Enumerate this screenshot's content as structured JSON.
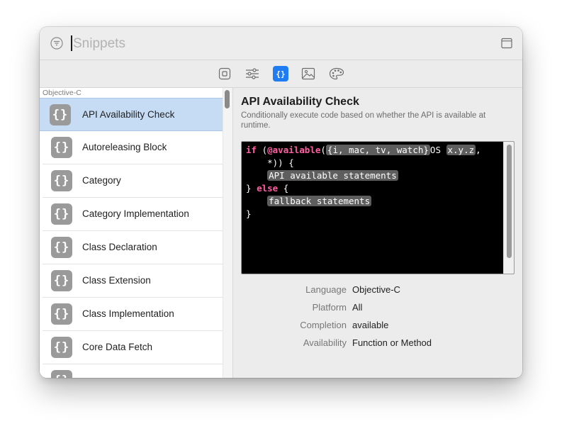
{
  "search": {
    "placeholder": "Snippets",
    "value": ""
  },
  "toolbar": {
    "tabs": [
      {
        "icon": "square-icon"
      },
      {
        "icon": "sliders-icon"
      },
      {
        "icon": "braces-icon",
        "active": true
      },
      {
        "icon": "image-icon"
      },
      {
        "icon": "palette-icon"
      }
    ],
    "accent": "#1f7cf2"
  },
  "sidebar": {
    "group_label": "Objective-C",
    "icon_glyph": "{}",
    "items": [
      {
        "label": "API Availability Check",
        "selected": true
      },
      {
        "label": "Autoreleasing Block"
      },
      {
        "label": "Category"
      },
      {
        "label": "Category Implementation"
      },
      {
        "label": "Class Declaration"
      },
      {
        "label": "Class Extension"
      },
      {
        "label": "Class Implementation"
      },
      {
        "label": "Core Data Fetch"
      },
      {
        "label": ""
      }
    ]
  },
  "detail": {
    "title": "API Availability Check",
    "description": "Conditionally execute code based on whether the API is available at runtime.",
    "code": {
      "kw_if": "if",
      "paren_open": " (",
      "kw_available": "@available",
      "paren2": "(",
      "ph_platform": "{i, mac, tv, watch}",
      "os": "OS ",
      "ph_version": "x.y.z",
      "comma": ",",
      "line2": "    *)) {",
      "indent": "    ",
      "ph_available": "API available statements",
      "brace_close": "} ",
      "kw_else": "else",
      "brace_open": " {",
      "ph_fallback": "fallback statements",
      "end": "}"
    },
    "properties": [
      {
        "key": "Language",
        "value": "Objective-C"
      },
      {
        "key": "Platform",
        "value": "All"
      },
      {
        "key": "Completion",
        "value": "available"
      },
      {
        "key": "Availability",
        "value": "Function or Method"
      }
    ]
  }
}
